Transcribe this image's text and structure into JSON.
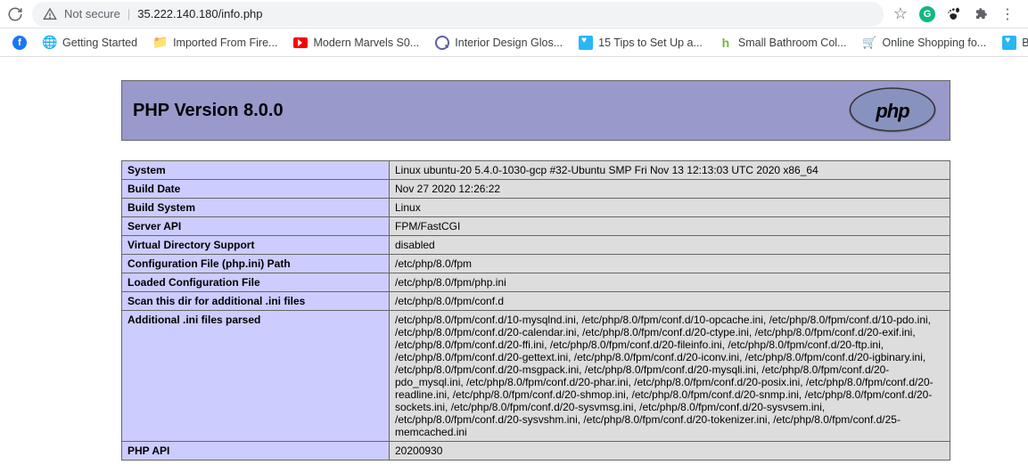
{
  "browser": {
    "not_secure": "Not secure",
    "url": "35.222.140.180/info.php"
  },
  "bookmarks": [
    {
      "label": "",
      "icon": "fb"
    },
    {
      "label": "Getting Started",
      "icon": "globe"
    },
    {
      "label": "Imported From Fire...",
      "icon": "folder"
    },
    {
      "label": "Modern Marvels S0...",
      "icon": "yt"
    },
    {
      "label": "Interior Design Glos...",
      "icon": "q"
    },
    {
      "label": "15 Tips to Set Up a...",
      "icon": "bluesq"
    },
    {
      "label": "Small Bathroom Col...",
      "icon": "greenh"
    },
    {
      "label": "Online Shopping fo...",
      "icon": "cart"
    },
    {
      "label": "Basic In",
      "icon": "bluesq"
    }
  ],
  "header_title": "PHP Version 8.0.0",
  "rows": [
    {
      "k": "System",
      "v": "Linux ubuntu-20 5.4.0-1030-gcp #32-Ubuntu SMP Fri Nov 13 12:13:03 UTC 2020 x86_64"
    },
    {
      "k": "Build Date",
      "v": "Nov 27 2020 12:26:22"
    },
    {
      "k": "Build System",
      "v": "Linux"
    },
    {
      "k": "Server API",
      "v": "FPM/FastCGI"
    },
    {
      "k": "Virtual Directory Support",
      "v": "disabled"
    },
    {
      "k": "Configuration File (php.ini) Path",
      "v": "/etc/php/8.0/fpm"
    },
    {
      "k": "Loaded Configuration File",
      "v": "/etc/php/8.0/fpm/php.ini"
    },
    {
      "k": "Scan this dir for additional .ini files",
      "v": "/etc/php/8.0/fpm/conf.d"
    },
    {
      "k": "Additional .ini files parsed",
      "v": "/etc/php/8.0/fpm/conf.d/10-mysqlnd.ini, /etc/php/8.0/fpm/conf.d/10-opcache.ini, /etc/php/8.0/fpm/conf.d/10-pdo.ini, /etc/php/8.0/fpm/conf.d/20-calendar.ini, /etc/php/8.0/fpm/conf.d/20-ctype.ini, /etc/php/8.0/fpm/conf.d/20-exif.ini, /etc/php/8.0/fpm/conf.d/20-ffi.ini, /etc/php/8.0/fpm/conf.d/20-fileinfo.ini, /etc/php/8.0/fpm/conf.d/20-ftp.ini, /etc/php/8.0/fpm/conf.d/20-gettext.ini, /etc/php/8.0/fpm/conf.d/20-iconv.ini, /etc/php/8.0/fpm/conf.d/20-igbinary.ini, /etc/php/8.0/fpm/conf.d/20-msgpack.ini, /etc/php/8.0/fpm/conf.d/20-mysqli.ini, /etc/php/8.0/fpm/conf.d/20-pdo_mysql.ini, /etc/php/8.0/fpm/conf.d/20-phar.ini, /etc/php/8.0/fpm/conf.d/20-posix.ini, /etc/php/8.0/fpm/conf.d/20-readline.ini, /etc/php/8.0/fpm/conf.d/20-shmop.ini, /etc/php/8.0/fpm/conf.d/20-snmp.ini, /etc/php/8.0/fpm/conf.d/20-sockets.ini, /etc/php/8.0/fpm/conf.d/20-sysvmsg.ini, /etc/php/8.0/fpm/conf.d/20-sysvsem.ini, /etc/php/8.0/fpm/conf.d/20-sysvshm.ini, /etc/php/8.0/fpm/conf.d/20-tokenizer.ini, /etc/php/8.0/fpm/conf.d/25-memcached.ini"
    },
    {
      "k": "PHP API",
      "v": "20200930"
    }
  ]
}
